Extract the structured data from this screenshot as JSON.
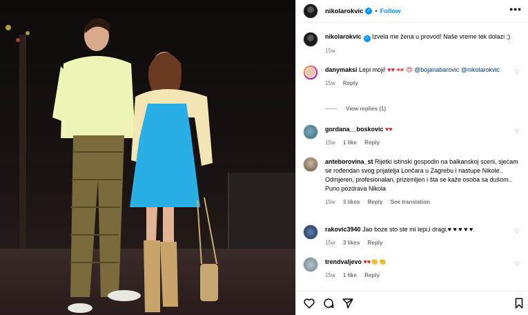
{
  "post": {
    "username": "nikolarokvic",
    "follow_label": "Follow",
    "more_label": "•••"
  },
  "caption": {
    "username": "nikolarokvic",
    "text": "Izvela me žena u provod! Naše vreme tek dolazi ;)",
    "time": "15w"
  },
  "comments": [
    {
      "username": "danymaksi",
      "text_before": "Lepi moji!",
      "emoji": "♥♥ 🕶 😍",
      "mentions": [
        "@bojanabarovic",
        "@nikolarokvic"
      ],
      "time": "15w",
      "likes": "",
      "reply_label": "Reply",
      "view_replies": "View replies (1)"
    },
    {
      "username": "gordana__boskovic",
      "text": "♥♥",
      "time": "15w",
      "likes": "1 like",
      "reply_label": "Reply"
    },
    {
      "username": "anteborovina_st",
      "text": "Rijetki istinski gospodin na balkanskoj sceni, sjećam se rođendan svog prijatelja Lončara u Zagrebu i nastupe Nikole..",
      "text2": "Odmjeren, profesionalan, prizemljen i šta se kaže osoba sa dušom.. Puno pozdrava Nikola",
      "time": "15w",
      "likes": "3 likes",
      "reply_label": "Reply",
      "translation_label": "See translation"
    },
    {
      "username": "rakovic3940",
      "text": "Jao boze sto ste mi lepi,i dragi.♥ ♥ ♥ ♥ ♥.",
      "time": "15w",
      "likes": "3 likes",
      "reply_label": "Reply"
    },
    {
      "username": "trendvaljevo",
      "text": "♥♥👏👏",
      "time": "15w",
      "likes": "1 like",
      "reply_label": "Reply"
    }
  ],
  "icons": {
    "like": "heart-icon",
    "comment": "comment-icon",
    "share": "share-icon",
    "save": "bookmark-icon",
    "verified": "verified-badge-icon"
  },
  "colors": {
    "accent": "#0095f6",
    "heart": "#ed1c24",
    "muted": "#737373"
  }
}
